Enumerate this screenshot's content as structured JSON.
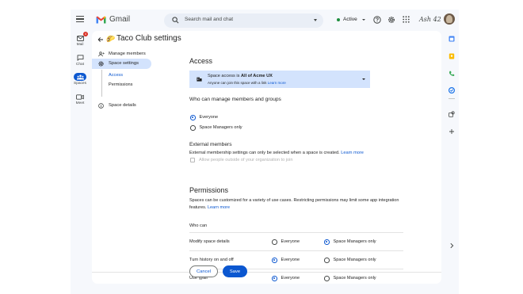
{
  "header": {
    "app_name": "Gmail",
    "search_placeholder": "Search mail and chat",
    "status": "Active",
    "signature": "Ash 42"
  },
  "rail": {
    "mail_label": "Mail",
    "mail_badge": "4",
    "chat_label": "Chat",
    "spaces_label": "Spaces",
    "meet_label": "Meet"
  },
  "page": {
    "title": "Taco Club settings",
    "emoji": "🌮"
  },
  "nav": {
    "manage_members": "Manage members",
    "space_settings": "Space settings",
    "access": "Access",
    "permissions": "Permissions",
    "space_details": "Space details"
  },
  "access": {
    "heading": "Access",
    "banner_prefix": "Space access is ",
    "banner_bold": "All of Acme UX",
    "banner_sub": "Anyone can join this space with a link ",
    "banner_link": "Learn more"
  },
  "manage": {
    "heading": "Who can manage members and groups",
    "option_everyone": "Everyone",
    "option_managers": "Space Managers only",
    "selected": "Everyone"
  },
  "external": {
    "heading": "External members",
    "text": "External membership settings can only be selected when a space is created. ",
    "link": "Learn more",
    "checkbox_label": "Allow people outside of your organization to join"
  },
  "permissions": {
    "heading": "Permissions",
    "description": "Spaces can be customized for a variety of use cases. Restricting permissions may limit some app integration features. ",
    "link": "Learn more",
    "who_can": "Who can",
    "option_everyone": "Everyone",
    "option_managers": "Space Managers only",
    "rows": [
      {
        "label": "Modify space details",
        "selected": "Space Managers only"
      },
      {
        "label": "Turn history on and off",
        "selected": "Everyone"
      },
      {
        "label": "Use @all",
        "selected": "Everyone"
      }
    ]
  },
  "footer": {
    "cancel": "Cancel",
    "save": "Save"
  },
  "colors": {
    "accent": "#0b57d0",
    "selected_bg": "#d3e3fd",
    "app_bg": "#f6f8fc"
  }
}
